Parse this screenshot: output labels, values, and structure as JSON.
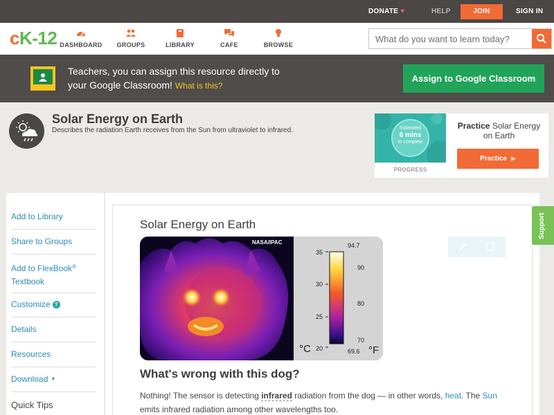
{
  "topbar": {
    "donate": "DONATE",
    "help": "HELP",
    "join": "JOIN",
    "signin": "SIGN IN"
  },
  "logo": {
    "c": "c",
    "k": "K-12"
  },
  "nav": [
    {
      "label": "DASHBOARD",
      "icon": "dashboard-icon"
    },
    {
      "label": "GROUPS",
      "icon": "groups-icon"
    },
    {
      "label": "LIBRARY",
      "icon": "library-icon"
    },
    {
      "label": "CAFE",
      "icon": "cafe-icon"
    },
    {
      "label": "BROWSE",
      "icon": "browse-icon"
    }
  ],
  "search": {
    "placeholder": "What do you want to learn today?"
  },
  "banner": {
    "text_line1": "Teachers, you can assign this resource directly to",
    "text_line2": "your Google Classroom!",
    "what_link": "What is this?",
    "assign_button": "Assign to Google Classroom"
  },
  "topic": {
    "title": "Solar Energy on Earth",
    "description": "Describes the radiation Earth receives from the Sun from ultraviolet to infrared."
  },
  "practice_card": {
    "estimated": "Estimated",
    "mins": "6 mins",
    "to_complete": "to complete",
    "progress": "PROGRESS",
    "practice_bold": "Practice",
    "practice_title": "Solar Energy on Earth",
    "button": "Practice"
  },
  "sidebar": {
    "items": [
      {
        "label": "Add to Library"
      },
      {
        "label": "Share to Groups"
      },
      {
        "label_a": "Add to FlexBook",
        "label_sup": "®",
        "label_b": "Textbook"
      },
      {
        "label": "Customize",
        "help": "?"
      },
      {
        "label": "Details"
      },
      {
        "label": "Resources"
      },
      {
        "label": "Download",
        "caret": "▼"
      }
    ],
    "quick_tips": "Quick Tips"
  },
  "main": {
    "title": "Solar Energy on Earth",
    "image": {
      "credit": "NASA/IPAC",
      "celsius_ticks": [
        "35",
        "30",
        "25",
        "20"
      ],
      "fahrenheit_ticks": [
        "94.7",
        "90",
        "80",
        "70",
        "69.6"
      ],
      "celsius_unit": "°C",
      "fahrenheit_unit": "°F"
    },
    "question": "What's wrong with this dog?",
    "body": {
      "p1": "Nothing! The sensor is detecting ",
      "term": "infrared",
      "p2": " radiation from the dog — in other words, ",
      "heat": "heat",
      "p3": ". The ",
      "sun": "Sun",
      "p4": "emits infrared radiation among other wavelengths too."
    }
  },
  "support": "Support"
}
